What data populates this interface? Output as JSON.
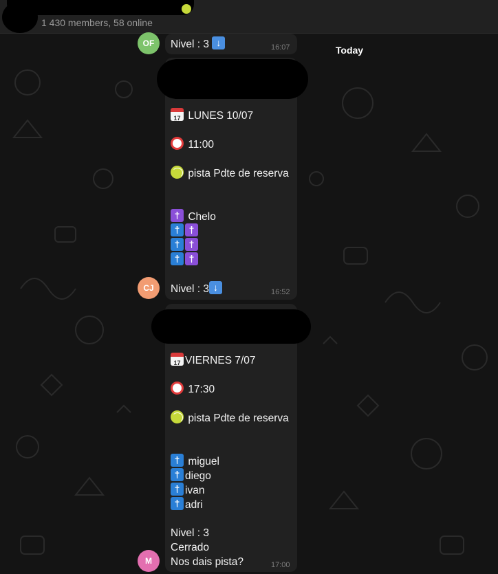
{
  "header": {
    "subtitle": "1 430 members, 58 online"
  },
  "date_separator": "Today",
  "messages": [
    {
      "avatar_initials": "OF",
      "avatar_color": "#7dc36b",
      "text": "Nivel : 3",
      "time": "16:07"
    },
    {
      "avatar_initials": "CJ",
      "avatar_color": "#f29c72",
      "lines": {
        "date": "LUNES 10/07",
        "hour": "11:00",
        "court": "pista Pdte de reserva",
        "p1": "Chelo",
        "level": "Nivel : 3"
      },
      "time": "16:52"
    },
    {
      "avatar_initials": "M",
      "avatar_color": "#e36fb0",
      "lines": {
        "date": "VIERNES 7/07",
        "hour": "17:30",
        "court": "pista Pdte de reserva",
        "p1": "miguel",
        "p2": "diego",
        "p3": "ivan",
        "p4": "adri",
        "level": "Nivel : 3",
        "status": "Cerrado",
        "question": "Nos dais pista?"
      },
      "time": "17:00"
    }
  ],
  "colors": {
    "background": "#141414",
    "bubble": "#212121",
    "header": "#212121"
  },
  "icons": [
    "calendar-icon",
    "alarm-clock-icon",
    "tennis-ball-icon",
    "person-purple-icon",
    "person-blue-icon",
    "down-arrow-icon"
  ]
}
